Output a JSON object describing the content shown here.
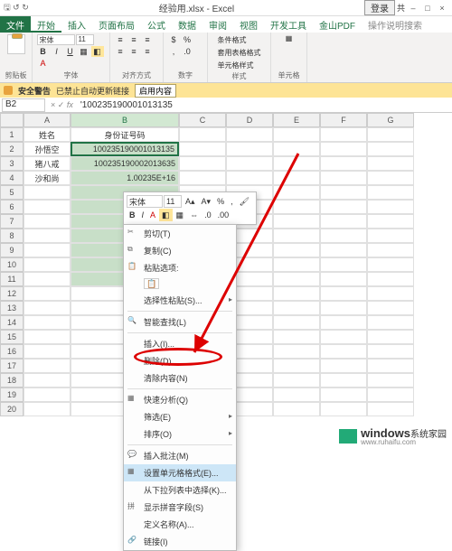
{
  "titlebar": {
    "file": "经验用.xlsx",
    "app": "Excel",
    "login": "登录",
    "share": "共",
    "min": "–",
    "max": "□",
    "close": "×"
  },
  "tabs": {
    "file": "文件",
    "home": "开始",
    "insert": "插入",
    "layout": "页面布局",
    "formula": "公式",
    "data": "数据",
    "review": "审阅",
    "view": "视图",
    "dev": "开发工具",
    "pdf": "金山PDF",
    "tellme": "操作说明搜索"
  },
  "ribbon": {
    "clipboard": "剪贴板",
    "font_name": "宋体",
    "font_size": "11",
    "font_group": "字体",
    "align_group": "对齐方式",
    "number_group": "数字",
    "cond_fmt": "条件格式",
    "table_fmt": "套用表格格式",
    "cell_style": "单元格样式",
    "styles_group": "样式",
    "cells_group": "单元格"
  },
  "warn": {
    "label": "安全警告",
    "text": "已禁止自动更新链接",
    "btn": "启用内容"
  },
  "formula": {
    "namebox": "B2",
    "value": "'100235190001013135"
  },
  "cols": {
    "A": "A",
    "B": "B",
    "C": "C",
    "D": "D",
    "E": "E",
    "F": "F",
    "G": "G"
  },
  "cells": {
    "A1": "姓名",
    "B1": "身份证号码",
    "A2": "孙悟空",
    "B2": "100235190001013135",
    "A3": "猪八戒",
    "B3": "100235190002013635",
    "A4": "沙和尚",
    "B4": "1.00235E+16"
  },
  "minibar": {
    "font": "宋体",
    "size": "11",
    "percent": "%"
  },
  "ctx": {
    "cut": "剪切(T)",
    "copy": "复制(C)",
    "paste_opts": "粘贴选项:",
    "paste_special": "选择性粘贴(S)...",
    "smart_lookup": "智能查找(L)",
    "insert": "插入(I)...",
    "delete": "删除(D)...",
    "clear": "清除内容(N)",
    "quick_analysis": "快速分析(Q)",
    "filter": "筛选(E)",
    "sort": "排序(O)",
    "insert_comment": "插入批注(M)",
    "format_cells": "设置单元格格式(E)...",
    "dropdown": "从下拉列表中选择(K)...",
    "phonetic": "显示拼音字段(S)",
    "define_name": "定义名称(A)...",
    "hyperlink": "链接(I)"
  },
  "watermark": {
    "brand": "windows",
    "sub": "系统家园",
    "url": "www.ruhaifu.com"
  }
}
